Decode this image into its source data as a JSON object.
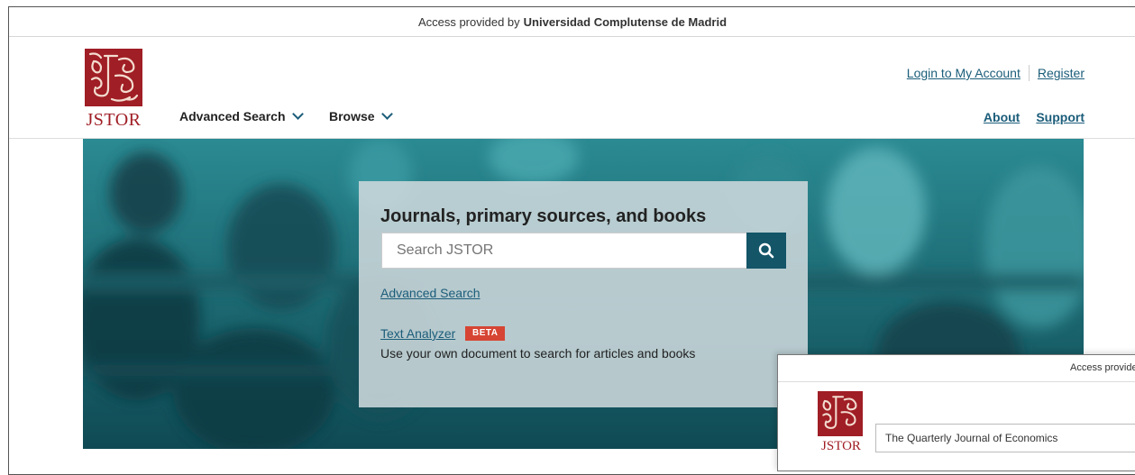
{
  "access_bar": {
    "prefix": "Access provided by",
    "institution": "Universidad Complutense de Madrid"
  },
  "logo": {
    "text": "JSTOR"
  },
  "nav": {
    "advanced_search": "Advanced Search",
    "browse": "Browse"
  },
  "account": {
    "login": "Login to My Account",
    "register": "Register"
  },
  "links": {
    "about": "About",
    "support": "Support"
  },
  "search_card": {
    "title": "Journals, primary sources, and books",
    "placeholder": "Search JSTOR",
    "advanced_link": "Advanced Search",
    "text_analyzer": "Text Analyzer",
    "beta": "BETA",
    "text_analyzer_desc": "Use your own document to search for articles and books"
  },
  "overlay": {
    "access_text": "Access provide",
    "logo_text": "JSTOR",
    "search_value": "The Quarterly Journal of Economics"
  },
  "colors": {
    "brand_red": "#a01e25",
    "link_teal": "#1b5d7a",
    "hero_teal": "#1f6f78",
    "beta_red": "#d64533"
  },
  "icons": {
    "search": "search-icon",
    "dropdown": "chevron-down-icon"
  }
}
